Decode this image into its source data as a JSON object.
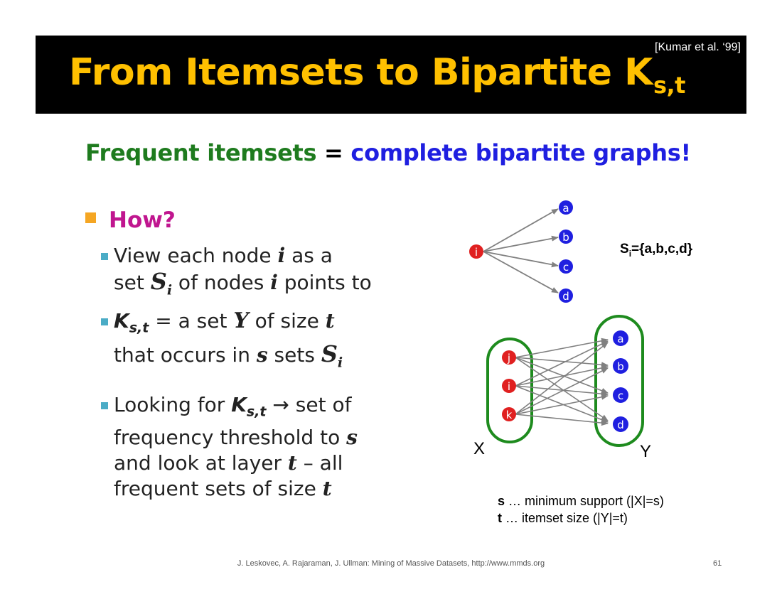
{
  "title_main": "From Itemsets to Bipartite K",
  "title_sub": "s,t",
  "citation": "[Kumar et al. ‘99]",
  "subtitle": {
    "left": "Frequent itemsets",
    "eq": " = ",
    "right": "complete bipartite graphs!"
  },
  "how": "How?",
  "bullets": {
    "b1": {
      "a": "View each node ",
      "i1": "i",
      "b": " as a",
      "c": "set ",
      "S": "S",
      "Ssub": "i",
      "d": " of nodes ",
      "i2": "i",
      "e": " points to"
    },
    "b2": {
      "K": "K",
      "Ksub": "s,t",
      "a": " = a set ",
      "Y": "Y",
      "b": " of size ",
      "t": "t",
      "c": "that occurs in ",
      "s": "s",
      "d": " sets ",
      "S": "S",
      "Ssub": "i"
    },
    "b3": {
      "a": "Looking for ",
      "K": "K",
      "Ksub": "s,t",
      "arrow": " → ",
      "b": "set of",
      "c": "frequency threshold to ",
      "s": "s",
      "d": "and look at layer ",
      "t1": "t",
      "e": " – all",
      "f": "frequent sets of size ",
      "t2": "t"
    }
  },
  "graph": {
    "center_node": "i",
    "targets": [
      "a",
      "b",
      "c",
      "d"
    ],
    "set_label": "S",
    "set_label_sub": "i",
    "set_label_rest": "={a,b,c,d}",
    "left_nodes": [
      "j",
      "i",
      "k"
    ],
    "right_nodes": [
      "a",
      "b",
      "c",
      "d"
    ],
    "x_label": "X",
    "y_label": "Y"
  },
  "definitions": {
    "s_key": "s",
    "s_text": " … minimum support (|X|=s)",
    "t_key": "t",
    "t_text": " … itemset size (|Y|=t)"
  },
  "footer": "J. Leskovec, A. Rajaraman, J. Ullman: Mining of Massive Datasets, http://www.mmds.org",
  "page_number": "61",
  "colors": {
    "title": "#FFC000",
    "green": "#1E7B1E",
    "blue": "#1F1FE0",
    "magenta": "#C0168F",
    "red_node": "#E02020",
    "blue_node": "#1F1FE0",
    "oval": "#1E8B1E",
    "edge": "#808080"
  }
}
